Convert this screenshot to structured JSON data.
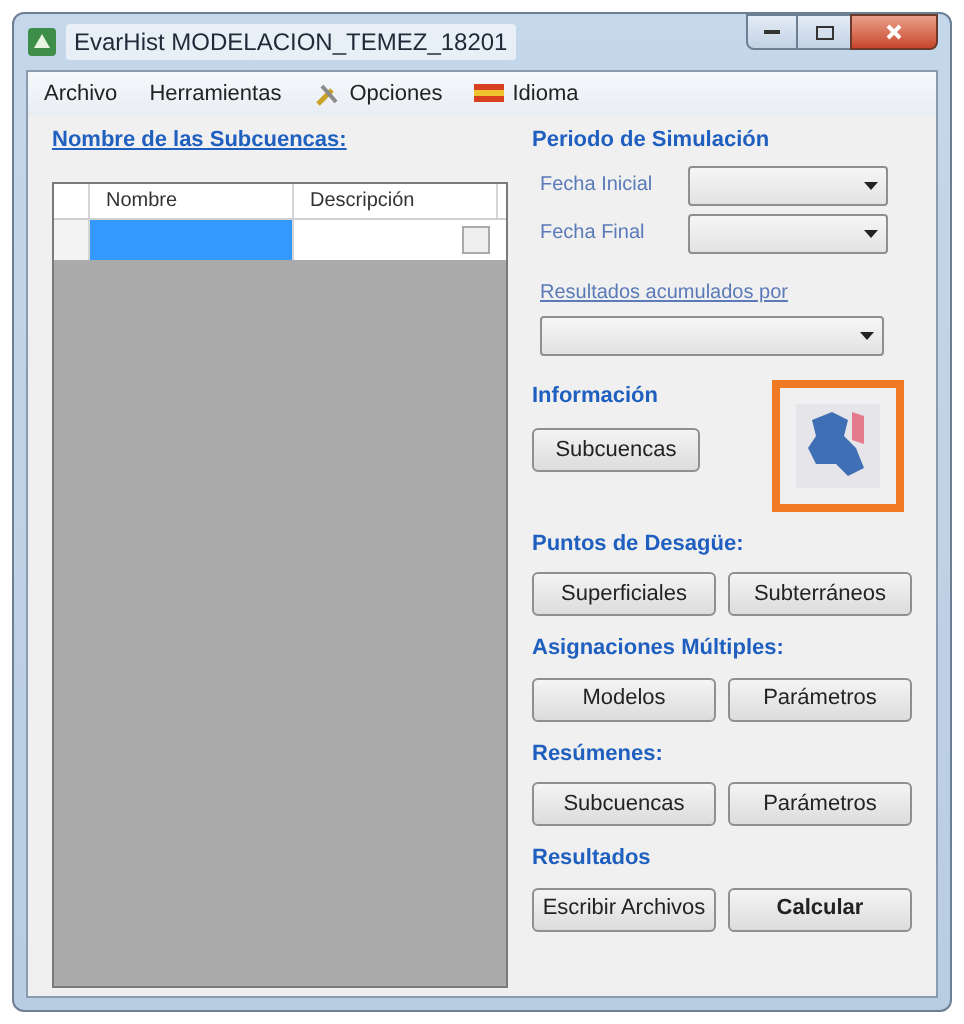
{
  "window": {
    "title": "EvarHist MODELACION_TEMEZ_18201"
  },
  "menu": [
    {
      "label": "Archivo",
      "kind": "plain"
    },
    {
      "label": "Herramientas",
      "kind": "plain"
    },
    {
      "label": "Opciones",
      "kind": "tools"
    },
    {
      "label": "Idioma",
      "kind": "language"
    }
  ],
  "subbasins": {
    "title": "Nombre de las Subcuencas:",
    "columns": [
      "Nombre",
      "Descripción"
    ],
    "rows": [
      {
        "selected": true
      }
    ]
  },
  "simulation_period": {
    "title": "Periodo de Simulación",
    "fields": [
      {
        "label": "Fecha Inicial"
      },
      {
        "label": "Fecha Final"
      }
    ],
    "accumulated_label": "Resultados acumulados por"
  },
  "information": {
    "title": "Información",
    "button": "Subcuencas",
    "map_button": {
      "highlighted": true
    }
  },
  "sections": [
    {
      "title": "Puntos de Desagüe:",
      "buttons": [
        {
          "label": "Superficiales",
          "emphasis": false
        },
        {
          "label": "Subterráneos",
          "emphasis": false
        }
      ]
    },
    {
      "title": "Asignaciones Múltiples:",
      "buttons": [
        {
          "label": "Modelos",
          "emphasis": false
        },
        {
          "label": "Parámetros",
          "emphasis": false
        }
      ]
    },
    {
      "title": "Resúmenes:",
      "buttons": [
        {
          "label": "Subcuencas",
          "emphasis": false
        },
        {
          "label": "Parámetros",
          "emphasis": false
        }
      ]
    },
    {
      "title": "Resultados",
      "buttons": [
        {
          "label": "Escribir Archivos",
          "emphasis": false
        },
        {
          "label": "Calcular",
          "emphasis": true
        }
      ]
    }
  ]
}
